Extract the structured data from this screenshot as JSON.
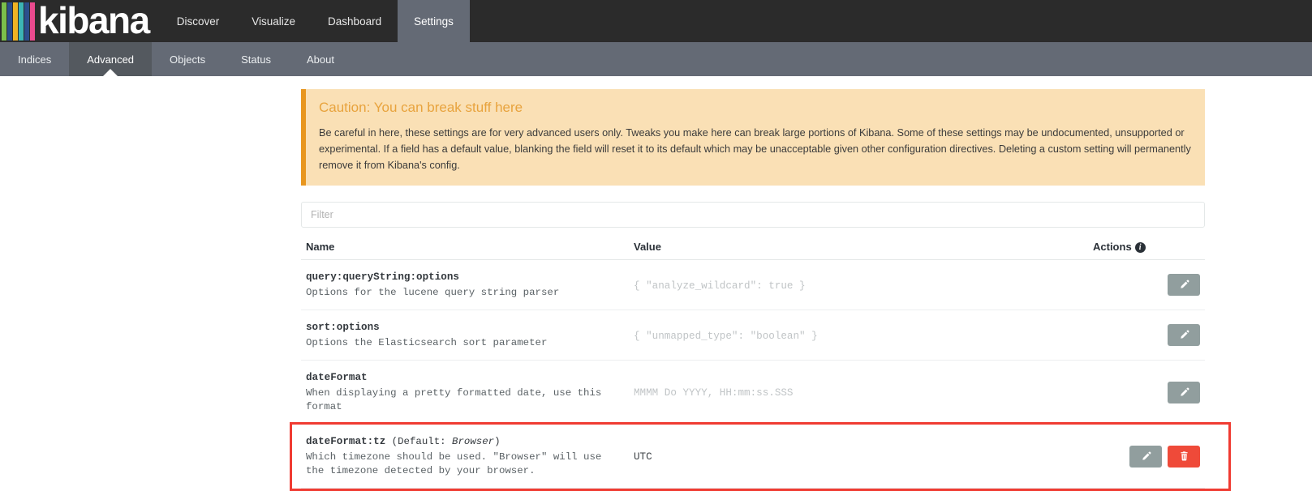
{
  "brand": {
    "name": "kibana",
    "logo_bar_colors": [
      "#7bbf4b",
      "#2b4e8c",
      "#f0b323",
      "#3cb5b5",
      "#2b4e8c",
      "#ea4a8e"
    ]
  },
  "topnav": {
    "tabs": [
      {
        "label": "Discover",
        "active": false
      },
      {
        "label": "Visualize",
        "active": false
      },
      {
        "label": "Dashboard",
        "active": false
      },
      {
        "label": "Settings",
        "active": true
      }
    ]
  },
  "subnav": {
    "tabs": [
      {
        "label": "Indices",
        "active": false
      },
      {
        "label": "Advanced",
        "active": true
      },
      {
        "label": "Objects",
        "active": false
      },
      {
        "label": "Status",
        "active": false
      },
      {
        "label": "About",
        "active": false
      }
    ]
  },
  "callout": {
    "title": "Caution: You can break stuff here",
    "body": "Be careful in here, these settings are for very advanced users only. Tweaks you make here can break large portions of Kibana. Some of these settings may be undocumented, unsupported or experimental. If a field has a default value, blanking the field will reset it to its default which may be unacceptable given other configuration directives. Deleting a custom setting will permanently remove it from Kibana's config.",
    "accent_color": "#e8961e",
    "background_color": "#fae0b5",
    "title_color": "#e8a33d"
  },
  "filter": {
    "placeholder": "Filter",
    "value": ""
  },
  "table": {
    "headers": {
      "name": "Name",
      "value": "Value",
      "actions": "Actions",
      "actions_info_icon": "info-icon"
    },
    "rows": [
      {
        "name": "query:queryString:options",
        "default": "",
        "description": "Options for the lucene query string parser",
        "value": "{ \"analyze_wildcard\": true }",
        "value_is_default": true,
        "has_delete": false,
        "highlighted": false
      },
      {
        "name": "sort:options",
        "default": "",
        "description": "Options the Elasticsearch sort parameter",
        "value": "{ \"unmapped_type\": \"boolean\" }",
        "value_is_default": true,
        "has_delete": false,
        "highlighted": false
      },
      {
        "name": "dateFormat",
        "default": "",
        "description": "When displaying a pretty formatted date, use this format",
        "value": "MMMM Do YYYY, HH:mm:ss.SSS",
        "value_is_default": true,
        "has_delete": false,
        "highlighted": false
      },
      {
        "name": "dateFormat:tz",
        "default_prefix": "(Default: ",
        "default_value": "Browser",
        "default_suffix": ")",
        "description": "Which timezone should be used. \"Browser\" will use the timezone detected by your browser.",
        "value": "UTC",
        "value_is_default": false,
        "has_delete": true,
        "highlighted": true
      }
    ],
    "edit_button_label": "edit",
    "delete_button_label": "delete",
    "edit_icon": "pencil-icon",
    "delete_icon": "trash-icon"
  },
  "annotation": {
    "highlight_color": "#f03b32"
  },
  "colors": {
    "topnav_bg": "#2b2b2b",
    "subnav_bg": "#646a75",
    "subnav_active_bg": "#54595f",
    "edit_button": "#919e9e",
    "delete_button": "#ef4a39"
  }
}
